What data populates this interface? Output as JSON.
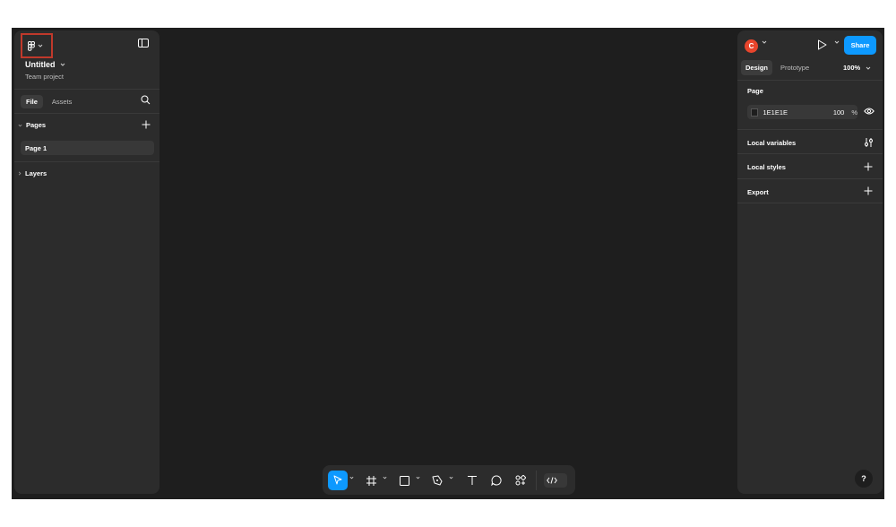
{
  "file": {
    "title": "Untitled",
    "subtitle": "Team project"
  },
  "left_tabs": {
    "file_label": "File",
    "assets_label": "Assets"
  },
  "pages_section": {
    "label": "Pages",
    "items": [
      {
        "label": "Page 1"
      }
    ]
  },
  "layers_section": {
    "label": "Layers"
  },
  "header_right": {
    "avatar_letter": "C",
    "share_label": "Share"
  },
  "right_tabs": {
    "design_label": "Design",
    "prototype_label": "Prototype",
    "zoom_value": "100%"
  },
  "page_props": {
    "heading": "Page",
    "background_hex": "1E1E1E",
    "opacity_value": "100",
    "opacity_unit": "%"
  },
  "right_rows": {
    "local_variables": "Local variables",
    "local_styles": "Local styles",
    "export": "Export"
  },
  "help_label": "?",
  "colors": {
    "canvas": "#1e1e1e",
    "panel": "#2c2c2c",
    "accent": "#0d99ff",
    "avatar": "#e8452c",
    "highlight_box": "#c0392b"
  },
  "icons": [
    "figma-logo-icon",
    "chevron-down-icon",
    "sidebar-toggle-icon",
    "search-icon",
    "plus-icon",
    "chevron-right-icon",
    "play-icon",
    "eye-icon",
    "variables-icon",
    "move-tool-icon",
    "frame-tool-icon",
    "rectangle-tool-icon",
    "pen-tool-icon",
    "text-tool-icon",
    "comment-tool-icon",
    "actions-tool-icon",
    "dev-mode-code-icon"
  ]
}
